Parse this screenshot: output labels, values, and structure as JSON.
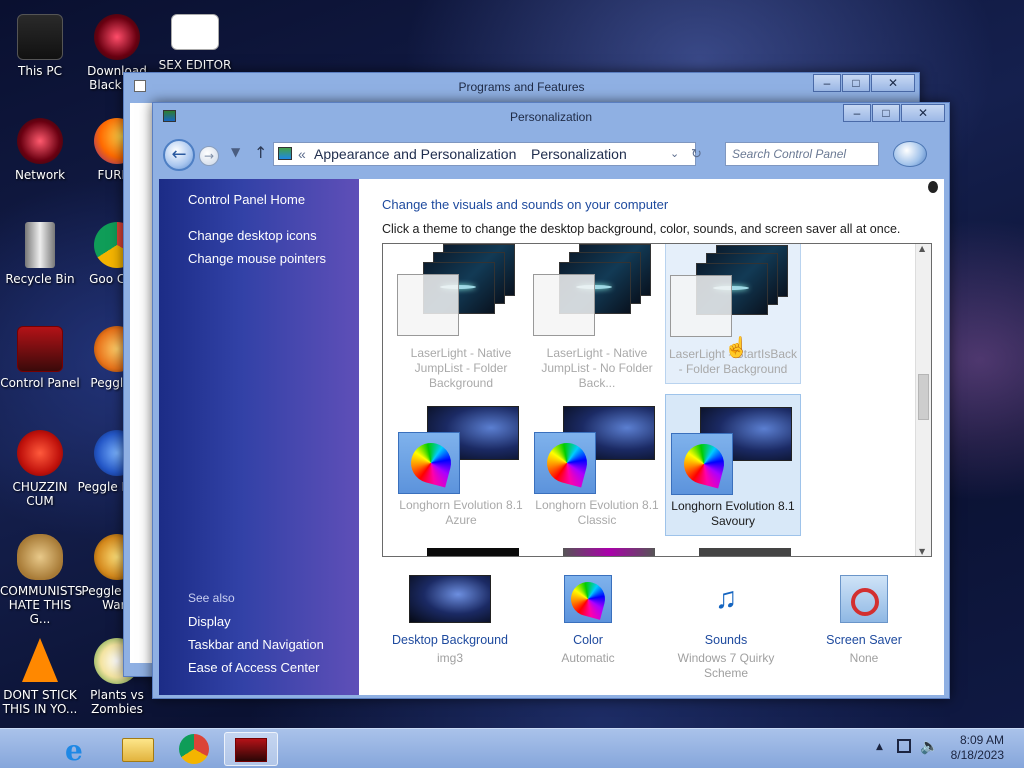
{
  "desktop": {
    "icons": [
      {
        "label": "This PC"
      },
      {
        "label": "Download Black A..."
      },
      {
        "label": "SEX EDITOR"
      },
      {
        "label": "Network"
      },
      {
        "label": "FURRY"
      },
      {
        "label": "Recycle Bin"
      },
      {
        "label": "Goo Chro"
      },
      {
        "label": "Control Panel"
      },
      {
        "label": "Peggle D"
      },
      {
        "label": "CHUZZIN CUM"
      },
      {
        "label": "Peggle I Delu"
      },
      {
        "label": "COMMUNISTS HATE THIS G..."
      },
      {
        "label": "Peggle W of Warc"
      },
      {
        "label": "DONT STICK THIS IN YO..."
      },
      {
        "label": "Plants vs Zombies"
      }
    ]
  },
  "programs_window": {
    "title": "Programs and Features"
  },
  "personalization": {
    "title": "Personalization",
    "breadcrumb": [
      "Appearance and Personalization",
      "Personalization"
    ],
    "breadcrumb_prefix": "«",
    "search_placeholder": "Search Control Panel",
    "sidebar": {
      "home": "Control Panel Home",
      "links": [
        "Change desktop icons",
        "Change mouse pointers"
      ],
      "see_also_heading": "See also",
      "see_also": [
        "Display",
        "Taskbar and Navigation",
        "Ease of Access Center"
      ]
    },
    "heading": "Change the visuals and sounds on your computer",
    "subheading": "Click a theme to change the desktop background, color, sounds, and screen saver all at once.",
    "themes": [
      {
        "name": "LaserLight - Native JumpList - Folder Background",
        "state": "normal"
      },
      {
        "name": "LaserLight - Native JumpList - No Folder Back...",
        "state": "normal"
      },
      {
        "name": "LaserLight - StartIsBack - Folder Background",
        "state": "hovered"
      },
      {
        "name": "Longhorn Evolution 8.1 Azure",
        "state": "normal"
      },
      {
        "name": "Longhorn Evolution 8.1 Classic",
        "state": "normal"
      },
      {
        "name": "Longhorn Evolution 8.1 Savoury",
        "state": "selected"
      }
    ],
    "bottom": [
      {
        "name": "Desktop Background",
        "value": "img3",
        "icon": "desktop-background-icon"
      },
      {
        "name": "Color",
        "value": "Automatic",
        "icon": "color-icon"
      },
      {
        "name": "Sounds",
        "value": "Windows 7 Quirky Scheme",
        "icon": "sounds-icon"
      },
      {
        "name": "Screen Saver",
        "value": "None",
        "icon": "screen-saver-icon"
      }
    ]
  },
  "taskbar": {
    "time": "8:09 AM",
    "date": "8/18/2023"
  }
}
